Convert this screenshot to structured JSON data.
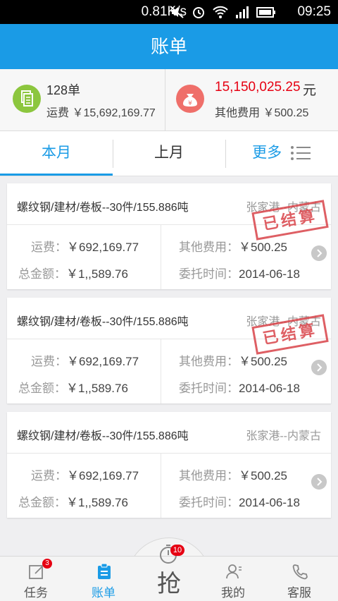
{
  "status_bar": {
    "speed": "0.81K/s",
    "time": "09:25",
    "icons": [
      "mute-icon",
      "alarm-icon",
      "wifi-icon",
      "signal-icon",
      "battery-icon"
    ]
  },
  "header": {
    "title": "账单"
  },
  "summary": {
    "count": "128单",
    "freight_label": "运费",
    "freight_value": "￥15,692,169.77",
    "total_amount": "15,150,025.25",
    "total_unit": "元",
    "other_label": "其他费用",
    "other_value": "￥500.25"
  },
  "tabs": {
    "this_month": "本月",
    "last_month": "上月",
    "more": "更多"
  },
  "bills": [
    {
      "title": "螺纹钢/建材/卷板--30件/155.886吨",
      "route": "张家港--内蒙古",
      "freight_label": "运费：",
      "freight": "￥692,169.77",
      "other_label": "其他费用：",
      "other": "￥500.25",
      "total_label": "总金额：",
      "total": "￥1,,589.76",
      "date_label": "委托时间：",
      "date": "2014-06-18",
      "stamp": "已结算"
    },
    {
      "title": "螺纹钢/建材/卷板--30件/155.886吨",
      "route": "张家港--内蒙古",
      "freight_label": "运费：",
      "freight": "￥692,169.77",
      "other_label": "其他费用：",
      "other": "￥500.25",
      "total_label": "总金额：",
      "total": "￥1,,589.76",
      "date_label": "委托时间：",
      "date": "2014-06-18",
      "stamp": "已结算"
    },
    {
      "title": "螺纹钢/建材/卷板--30件/155.886吨",
      "route": "张家港--内蒙古",
      "freight_label": "运费：",
      "freight": "￥692,169.77",
      "other_label": "其他费用：",
      "other": "￥500.25",
      "total_label": "总金额：",
      "total": "￥1,,589.76",
      "date_label": "委托时间：",
      "date": "2014-06-18",
      "stamp": ""
    }
  ],
  "bottom_nav": {
    "tasks": {
      "label": "任务",
      "badge": "3"
    },
    "bills": {
      "label": "账单"
    },
    "grab": {
      "label": "抢",
      "badge": "10"
    },
    "mine": {
      "label": "我的"
    },
    "service": {
      "label": "客服"
    }
  },
  "colors": {
    "primary": "#1a9be6",
    "red": "#e60012",
    "green": "#8cc63e",
    "stamp": "#d9444a"
  }
}
